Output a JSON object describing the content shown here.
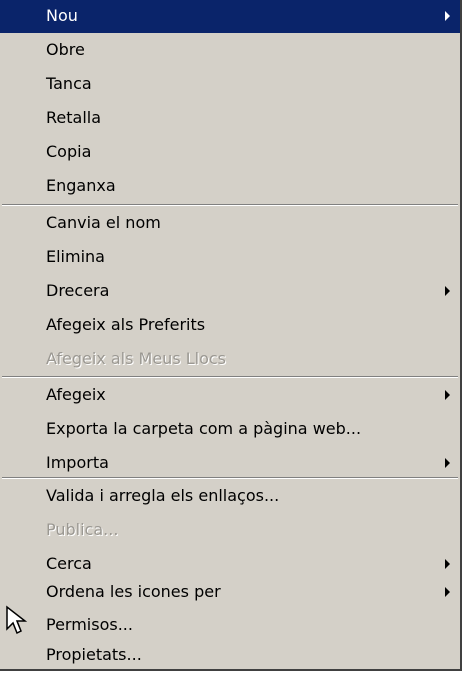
{
  "context_menu": {
    "items": [
      {
        "label": "Nou",
        "state": "highlighted",
        "submenu": true
      },
      {
        "label": "Obre",
        "state": "enabled",
        "submenu": false
      },
      {
        "label": "Tanca",
        "state": "enabled",
        "submenu": false
      },
      {
        "label": "Retalla",
        "state": "enabled",
        "submenu": false
      },
      {
        "label": "Copia",
        "state": "enabled",
        "submenu": false
      },
      {
        "label": "Enganxa",
        "state": "enabled",
        "submenu": false
      },
      {
        "label": "Canvia el nom",
        "state": "enabled",
        "submenu": false
      },
      {
        "label": "Elimina",
        "state": "enabled",
        "submenu": false
      },
      {
        "label": "Drecera",
        "state": "enabled",
        "submenu": true
      },
      {
        "label": "Afegeix als Preferits",
        "state": "enabled",
        "submenu": false
      },
      {
        "label": "Afegeix als Meus Llocs",
        "state": "disabled",
        "submenu": false
      },
      {
        "label": "Afegeix",
        "state": "enabled",
        "submenu": true
      },
      {
        "label": "Exporta la carpeta com a pàgina web...",
        "state": "enabled",
        "submenu": false
      },
      {
        "label": "Importa",
        "state": "enabled",
        "submenu": true
      },
      {
        "label": "Valida i arregla els enllaços...",
        "state": "enabled",
        "submenu": false
      },
      {
        "label": "Publica...",
        "state": "disabled",
        "submenu": false
      },
      {
        "label": "Cerca",
        "state": "enabled",
        "submenu": true
      },
      {
        "label": "Ordena les icones per",
        "state": "enabled",
        "submenu": true
      },
      {
        "label": "Permisos...",
        "state": "enabled",
        "submenu": false
      },
      {
        "label": "Propietats...",
        "state": "enabled",
        "submenu": false
      }
    ]
  },
  "colors": {
    "menu_background": "#d4d0c8",
    "highlight_background": "#0a246a",
    "highlight_text": "#ffffff",
    "disabled_text": "#9b9892"
  },
  "icons": {
    "submenu_arrow": "right-triangle",
    "mouse_cursor": "arrow-pointer"
  }
}
